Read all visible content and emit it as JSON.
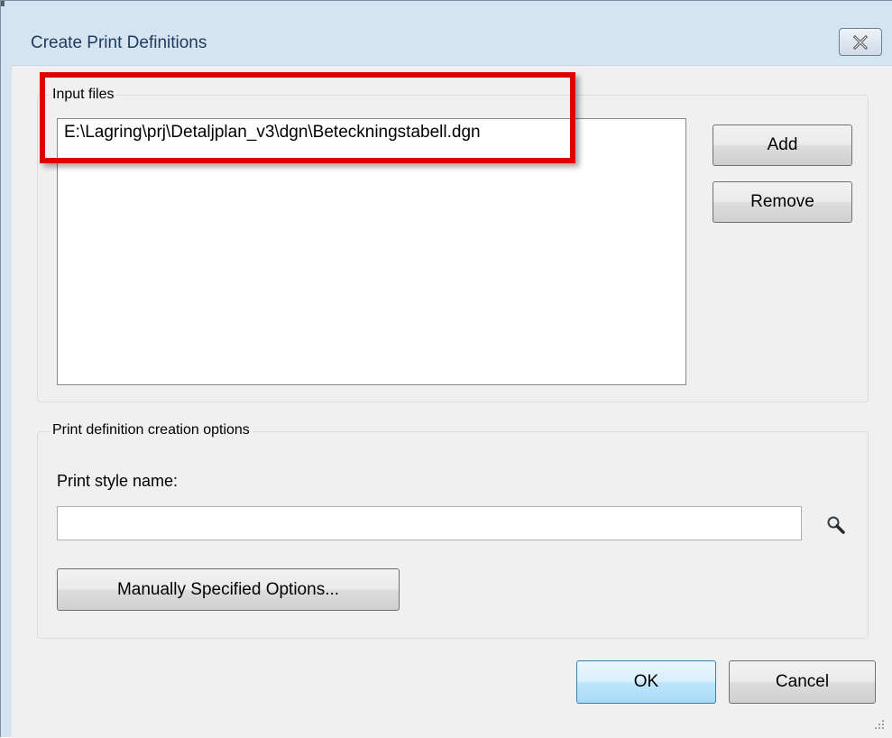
{
  "window": {
    "title": "Create Print Definitions",
    "close_icon": "close-icon"
  },
  "input_files": {
    "group_label": "Input files",
    "items": [
      "E:\\Lagring\\prj\\Detaljplan_v3\\dgn\\Beteckningstabell.dgn"
    ],
    "add_label": "Add",
    "remove_label": "Remove"
  },
  "options": {
    "group_label": "Print definition creation options",
    "print_style_label": "Print style name:",
    "print_style_value": "",
    "browse_icon": "search-icon",
    "manual_button_label": "Manually Specified Options..."
  },
  "footer": {
    "ok_label": "OK",
    "cancel_label": "Cancel"
  },
  "colors": {
    "highlight": "#e00000",
    "title_text": "#1e3a5c",
    "dialog_frame": "#d6e4f1",
    "client_bg": "#f0f0f0"
  }
}
